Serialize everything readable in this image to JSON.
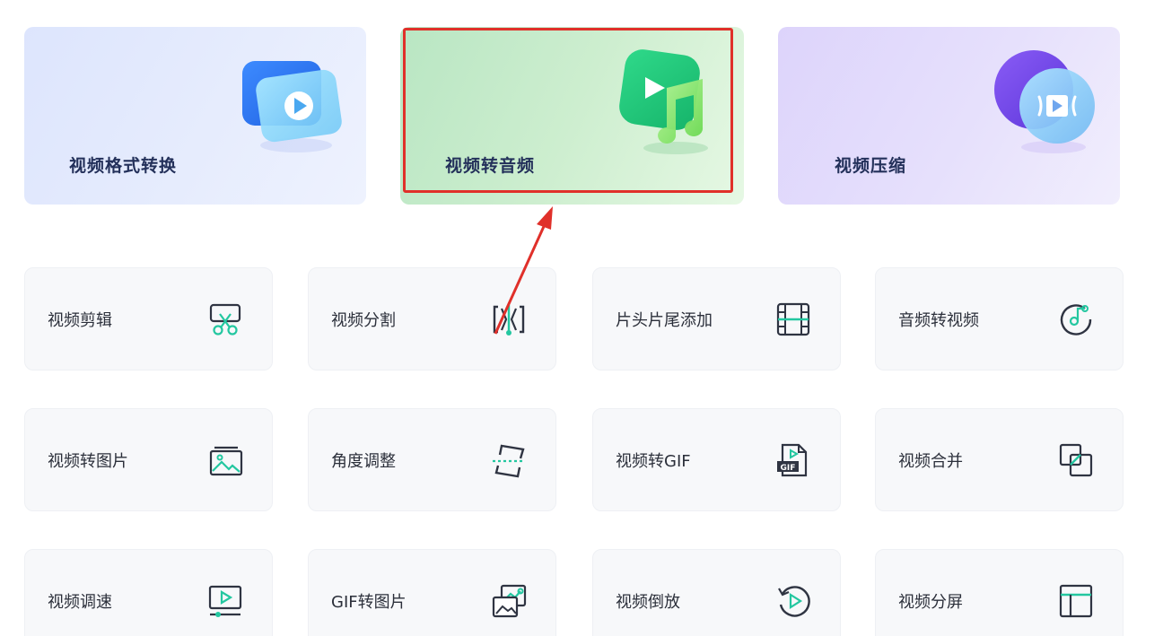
{
  "features": [
    {
      "id": "format",
      "label": "视频格式转换"
    },
    {
      "id": "audio",
      "label": "视频转音频"
    },
    {
      "id": "compress",
      "label": "视频压缩"
    }
  ],
  "tools": [
    {
      "label": "视频剪辑",
      "icon": "scissors-icon"
    },
    {
      "label": "视频分割",
      "icon": "split-icon"
    },
    {
      "label": "片头片尾添加",
      "icon": "film-strip-icon"
    },
    {
      "label": "音频转视频",
      "icon": "music-disc-icon"
    },
    {
      "label": "视频转图片",
      "icon": "image-icon"
    },
    {
      "label": "角度调整",
      "icon": "rotate-frame-icon"
    },
    {
      "label": "视频转GIF",
      "icon": "gif-file-icon"
    },
    {
      "label": "视频合并",
      "icon": "merge-icon"
    },
    {
      "label": "视频调速",
      "icon": "speed-monitor-icon"
    },
    {
      "label": "GIF转图片",
      "icon": "gif-to-image-icon"
    },
    {
      "label": "视频倒放",
      "icon": "reverse-play-icon"
    },
    {
      "label": "视频分屏",
      "icon": "split-screen-icon"
    }
  ],
  "colors": {
    "accent": "#23c7a0",
    "icon_stroke": "#2f3442",
    "highlight": "#e0302a"
  }
}
